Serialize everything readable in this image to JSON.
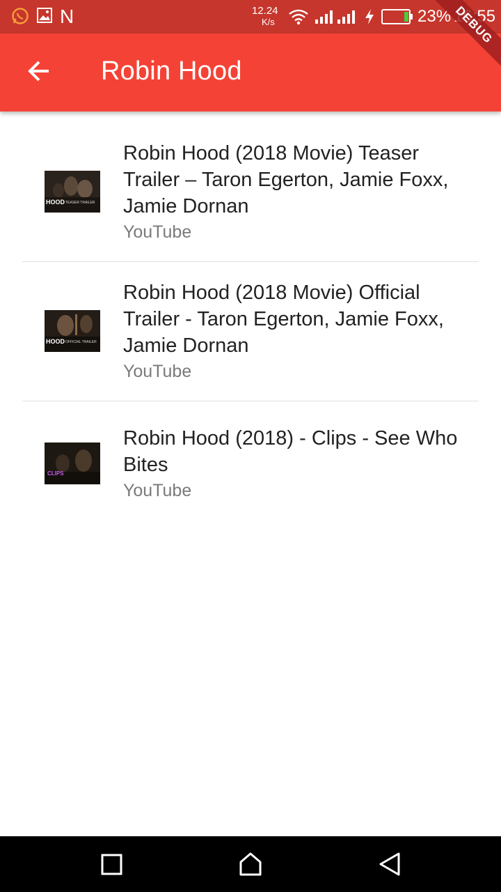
{
  "status_bar": {
    "net_speed": "12.24",
    "net_unit": "K/s",
    "battery_percent": "23%",
    "time": "16:55",
    "left_icons": [
      "whatsapp-icon",
      "image-icon",
      "n-icon"
    ],
    "n_letter": "N"
  },
  "app_bar": {
    "title": "Robin Hood",
    "debug_label": "DEBUG",
    "color": "#f44336"
  },
  "videos": [
    {
      "title": "Robin Hood (2018 Movie) Teaser Trailer – Taron Egerton, Jamie Foxx, Jamie Dornan",
      "source": "YouTube",
      "thumb_caption": "HOOD",
      "thumb_sub": "TEASER TRAILER"
    },
    {
      "title": "Robin Hood (2018 Movie) Official Trailer - Taron Egerton, Jamie Foxx, Jamie Dornan",
      "source": "YouTube",
      "thumb_caption": "HOOD",
      "thumb_sub": "OFFICIAL TRAILER"
    },
    {
      "title": "Robin Hood (2018) - Clips - See Who Bites",
      "source": "YouTube",
      "thumb_caption": "CLIPS",
      "thumb_sub": ""
    }
  ]
}
